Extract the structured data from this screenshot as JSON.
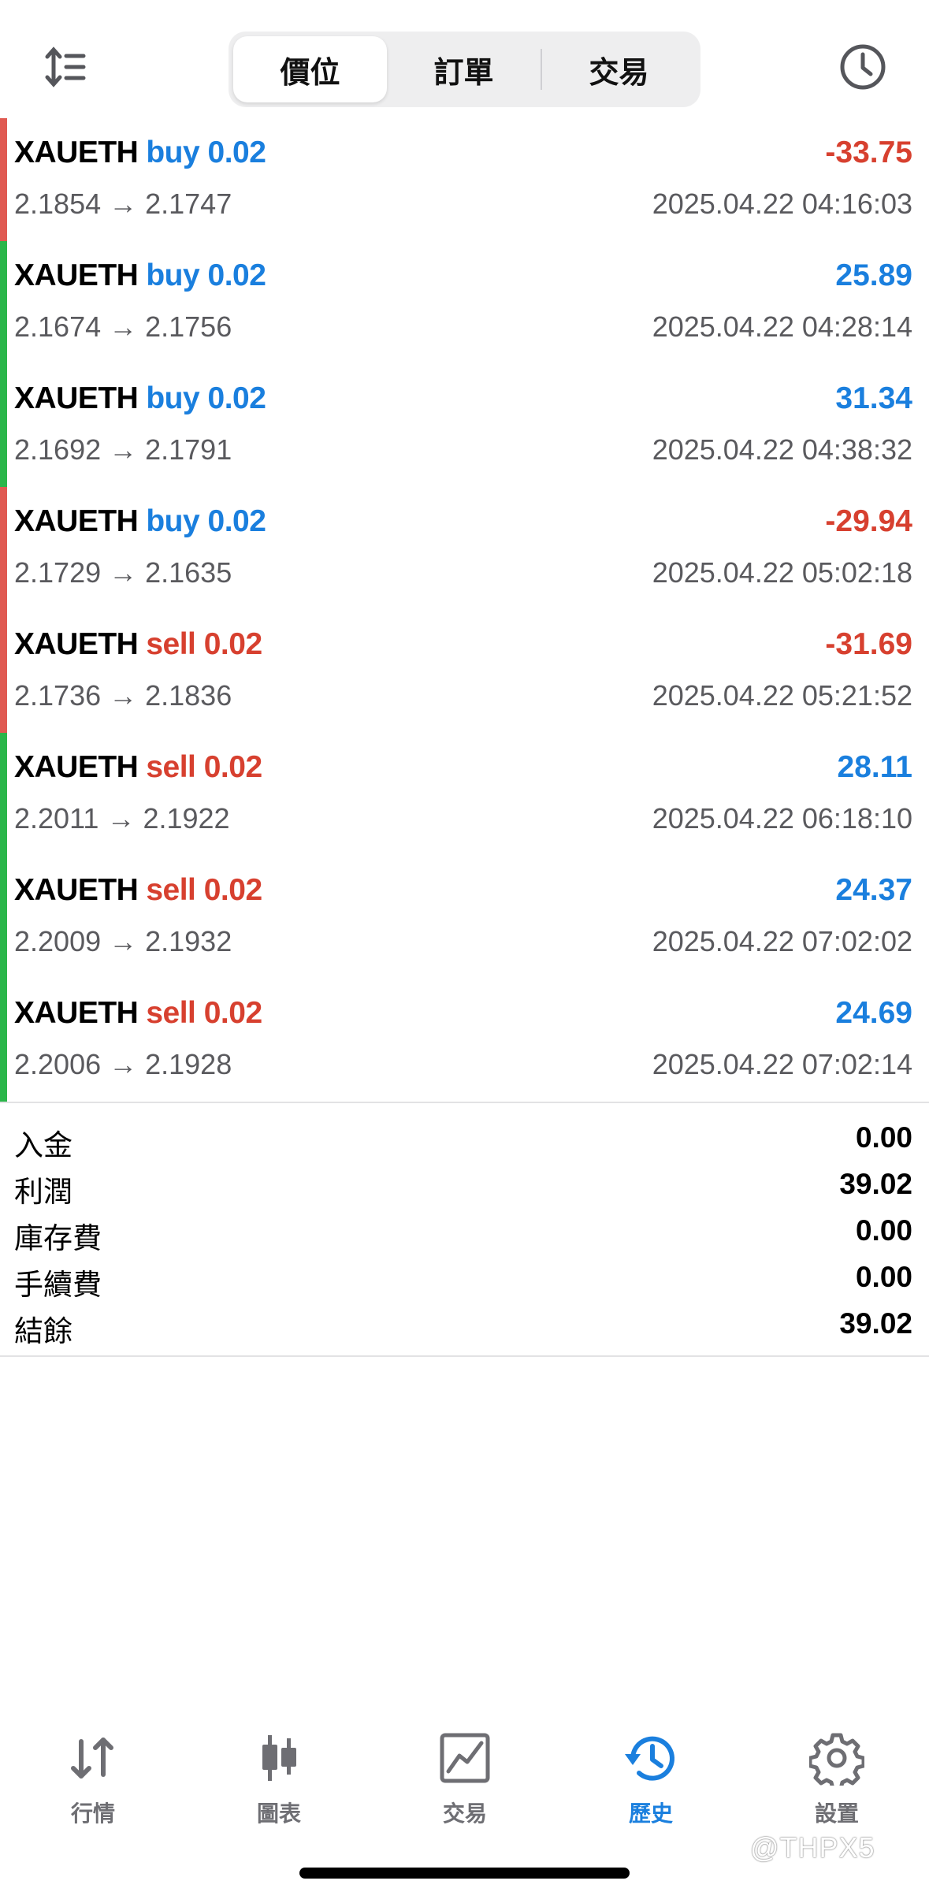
{
  "header": {
    "segments": [
      {
        "label": "價位",
        "active": true
      },
      {
        "label": "訂單",
        "active": false
      },
      {
        "label": "交易",
        "active": false
      }
    ],
    "left_icon": "sort-icon",
    "right_icon": "clock-icon"
  },
  "trades": [
    {
      "symbol": "XAUETH",
      "side": "buy 0.02",
      "prices": "2.1854 → 2.1747",
      "profit": "-33.75",
      "time": "2025.04.22 04:16:03",
      "result": "loss"
    },
    {
      "symbol": "XAUETH",
      "side": "buy 0.02",
      "prices": "2.1674 → 2.1756",
      "profit": "25.89",
      "time": "2025.04.22 04:28:14",
      "result": "win"
    },
    {
      "symbol": "XAUETH",
      "side": "buy 0.02",
      "prices": "2.1692 → 2.1791",
      "profit": "31.34",
      "time": "2025.04.22 04:38:32",
      "result": "win"
    },
    {
      "symbol": "XAUETH",
      "side": "buy 0.02",
      "prices": "2.1729 → 2.1635",
      "profit": "-29.94",
      "time": "2025.04.22 05:02:18",
      "result": "loss"
    },
    {
      "symbol": "XAUETH",
      "side": "sell 0.02",
      "prices": "2.1736 → 2.1836",
      "profit": "-31.69",
      "time": "2025.04.22 05:21:52",
      "result": "loss"
    },
    {
      "symbol": "XAUETH",
      "side": "sell 0.02",
      "prices": "2.2011 → 2.1922",
      "profit": "28.11",
      "time": "2025.04.22 06:18:10",
      "result": "win"
    },
    {
      "symbol": "XAUETH",
      "side": "sell 0.02",
      "prices": "2.2009 → 2.1932",
      "profit": "24.37",
      "time": "2025.04.22 07:02:02",
      "result": "win"
    },
    {
      "symbol": "XAUETH",
      "side": "sell 0.02",
      "prices": "2.2006 → 2.1928",
      "profit": "24.69",
      "time": "2025.04.22 07:02:14",
      "result": "win"
    }
  ],
  "summary": [
    {
      "label": "入金",
      "value": "0.00"
    },
    {
      "label": "利潤",
      "value": "39.02"
    },
    {
      "label": "庫存費",
      "value": "0.00"
    },
    {
      "label": "手續費",
      "value": "0.00"
    },
    {
      "label": "結餘",
      "value": "39.02"
    }
  ],
  "tabbar": [
    {
      "label": "行情",
      "icon": "quotes-arrows-icon",
      "active": false
    },
    {
      "label": "圖表",
      "icon": "candlestick-chart-icon",
      "active": false
    },
    {
      "label": "交易",
      "icon": "trade-chart-icon",
      "active": false
    },
    {
      "label": "歷史",
      "icon": "history-icon",
      "active": true
    },
    {
      "label": "設置",
      "icon": "settings-gear-icon",
      "active": false
    }
  ],
  "watermark": "@THPX5",
  "colors": {
    "profit_blue": "#1a7fde",
    "loss_red": "#d7402f",
    "win_bar": "#2bb64a",
    "loss_bar": "#e05a52",
    "inactive_gray": "#6e6e73"
  }
}
